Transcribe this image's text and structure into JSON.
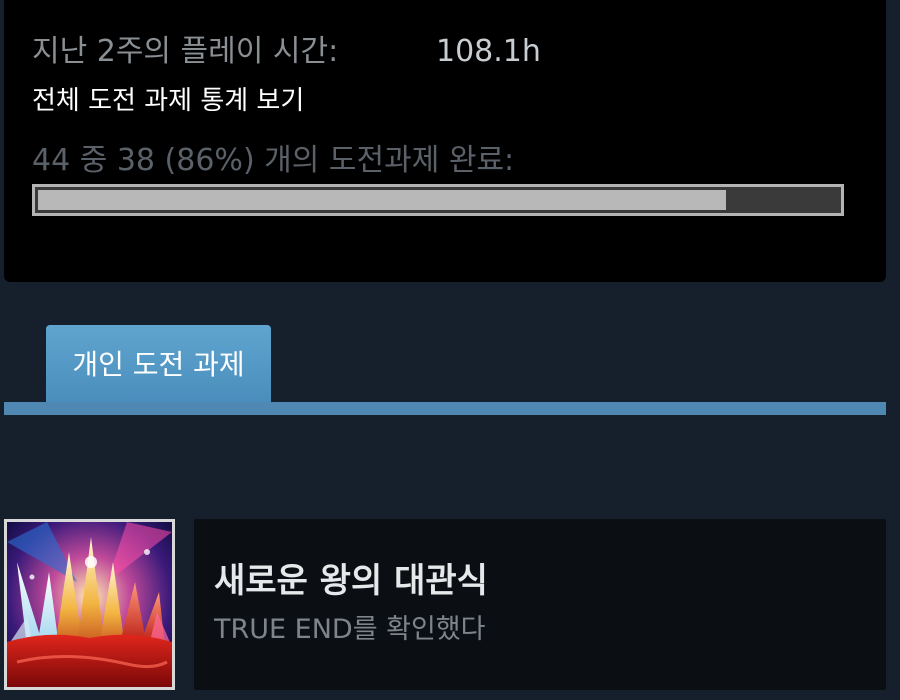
{
  "stats": {
    "playtime_label": "지난 2주의 플레이 시간:",
    "playtime_value": "108.1h",
    "view_stats_link": "전체 도전 과제 통계 보기",
    "progress_text": "44 중 38 (86%) 개의 도전과제 완료:",
    "progress_percent": 86
  },
  "tabs": [
    {
      "label": "개인 도전 과제"
    }
  ],
  "achievement": {
    "title": "새로운 왕의 대관식",
    "description": "TRUE END를 확인했다",
    "icon": "crown-spikes-icon"
  },
  "colors": {
    "background": "#16202d",
    "panel": "#000000",
    "tab": "#4e88b3",
    "progress_fill": "#b8b8b8"
  }
}
